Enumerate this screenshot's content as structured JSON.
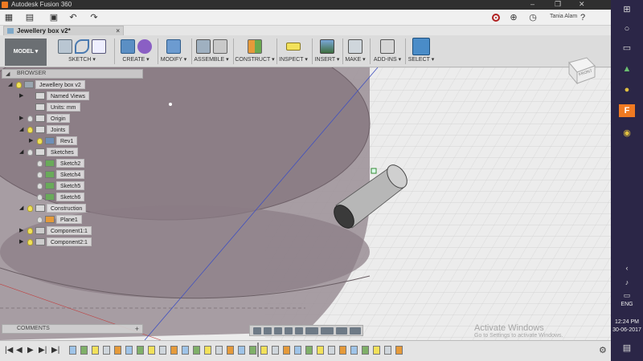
{
  "window": {
    "app_title": "Autodesk Fusion 360",
    "min": "–",
    "max": "❐",
    "close": "✕"
  },
  "qat": {
    "user_name": "Tania Alam"
  },
  "document_tab": {
    "label": "Jewellery box v2*",
    "close": "×"
  },
  "toolbar": {
    "workspace": "MODEL ▾",
    "groups": [
      {
        "label": "SKETCH ▾"
      },
      {
        "label": "CREATE ▾"
      },
      {
        "label": "MODIFY ▾"
      },
      {
        "label": "ASSEMBLE ▾"
      },
      {
        "label": "CONSTRUCT ▾"
      },
      {
        "label": "INSPECT ▾"
      },
      {
        "label": "INSERT ▾"
      },
      {
        "label": "MAKE ▾"
      },
      {
        "label": "ADD-INS ▾"
      },
      {
        "label": "SELECT ▾"
      }
    ]
  },
  "browser": {
    "title": "BROWSER",
    "items": [
      {
        "label": "Jewellery box v2",
        "arrow": "◢",
        "bulb": "on",
        "icon": "document-icon"
      },
      {
        "label": "Named Views",
        "arrow": "▶",
        "bulb": "none",
        "icon": "folder-icon"
      },
      {
        "label": "Units: mm",
        "arrow": "",
        "bulb": "none",
        "icon": "units-icon"
      },
      {
        "label": "Origin",
        "arrow": "▶",
        "bulb": "off",
        "icon": "folder-icon"
      },
      {
        "label": "Joints",
        "arrow": "◢",
        "bulb": "on",
        "icon": "folder-icon"
      },
      {
        "label": "Rev1",
        "arrow": "▶",
        "bulb": "on",
        "icon": "joint-icon"
      },
      {
        "label": "Sketches",
        "arrow": "◢",
        "bulb": "off",
        "icon": "folder-icon"
      },
      {
        "label": "Sketch2",
        "arrow": "",
        "bulb": "off",
        "icon": "sketch-icon"
      },
      {
        "label": "Sketch4",
        "arrow": "",
        "bulb": "off",
        "icon": "sketch-icon"
      },
      {
        "label": "Sketch5",
        "arrow": "",
        "bulb": "off",
        "icon": "sketch-icon"
      },
      {
        "label": "Sketch6",
        "arrow": "",
        "bulb": "off",
        "icon": "sketch-icon"
      },
      {
        "label": "Construction",
        "arrow": "◢",
        "bulb": "on",
        "icon": "folder-icon"
      },
      {
        "label": "Plane1",
        "arrow": "",
        "bulb": "off",
        "icon": "plane-icon"
      },
      {
        "label": "Component1:1",
        "arrow": "▶",
        "bulb": "on",
        "icon": "component-icon"
      },
      {
        "label": "Component2:1",
        "arrow": "▶",
        "bulb": "on",
        "icon": "component-icon"
      }
    ]
  },
  "comments": {
    "title": "COMMENTS",
    "add": "+"
  },
  "viewcube": {
    "face_label": "FRONT"
  },
  "watermark": {
    "line1": "Activate Windows",
    "line2": "Go to Settings to activate Windows."
  },
  "timeline": {
    "first": "|◀",
    "prev": "◀",
    "play": "▶",
    "next": "▶|",
    "last": "▶|",
    "settings": "⚙"
  },
  "taskbar": {
    "lang": "ENG",
    "time": "12:24 PM",
    "date": "30-06-2017"
  },
  "colors": {
    "taskbar_bg": "#2b2647",
    "model_button": "#6b6f73",
    "select_accent": "#4a8cc8",
    "body_shade": "#8a7f86"
  }
}
